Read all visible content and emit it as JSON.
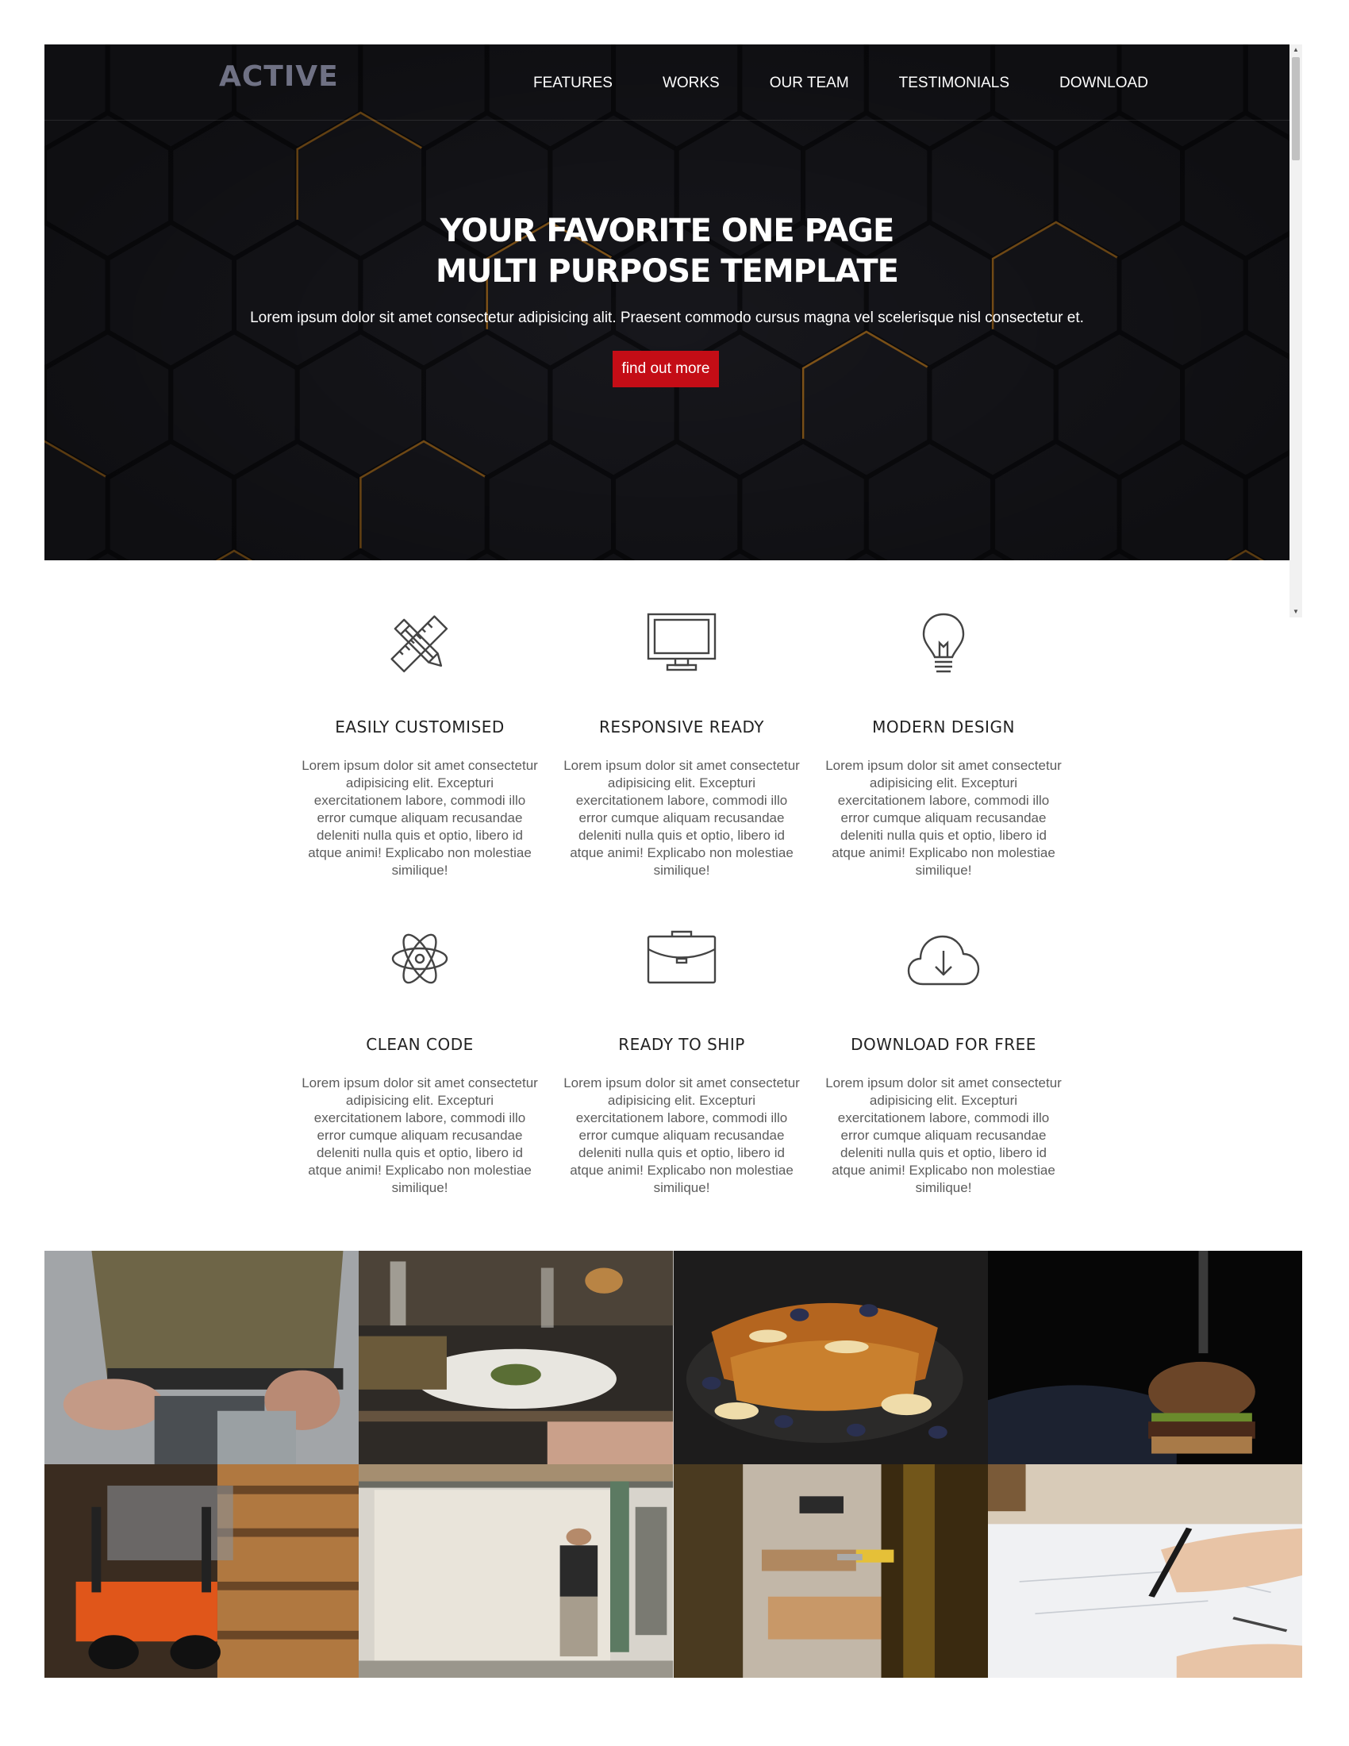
{
  "brand": {
    "logo": "ACTIVE"
  },
  "nav": {
    "items": [
      {
        "label": "FEATURES"
      },
      {
        "label": "WORKS"
      },
      {
        "label": "OUR TEAM"
      },
      {
        "label": "TESTIMONIALS"
      },
      {
        "label": "DOWNLOAD"
      }
    ]
  },
  "hero": {
    "title_line1": "YOUR FAVORITE ONE PAGE",
    "title_line2": "MULTI PURPOSE TEMPLATE",
    "subtitle": "Lorem ipsum dolor sit amet consectetur adipisicing alit. Praesent commodo cursus magna vel scelerisque nisl consectetur et.",
    "button_label": "find out more",
    "colors": {
      "background": "#121216",
      "accent_line": "#8a5a1a",
      "button": "#c40d16"
    }
  },
  "features": [
    {
      "icon": "pencil-ruler-icon",
      "title": "EASILY CUSTOMISED",
      "text": "Lorem ipsum dolor sit amet consectetur adipisicing elit. Excepturi exercitationem labore, commodi illo error cumque aliquam recusandae deleniti nulla quis et optio, libero id atque animi! Explicabo non molestiae similique!"
    },
    {
      "icon": "monitor-icon",
      "title": "RESPONSIVE READY",
      "text": "Lorem ipsum dolor sit amet consectetur adipisicing elit. Excepturi exercitationem labore, commodi illo error cumque aliquam recusandae deleniti nulla quis et optio, libero id atque animi! Explicabo non molestiae similique!"
    },
    {
      "icon": "lightbulb-icon",
      "title": "MODERN DESIGN",
      "text": "Lorem ipsum dolor sit amet consectetur adipisicing elit. Excepturi exercitationem labore, commodi illo error cumque aliquam recusandae deleniti nulla quis et optio, libero id atque animi! Explicabo non molestiae similique!"
    },
    {
      "icon": "atom-icon",
      "title": "CLEAN CODE",
      "text": "Lorem ipsum dolor sit amet consectetur adipisicing elit. Excepturi exercitationem labore, commodi illo error cumque aliquam recusandae deleniti nulla quis et optio, libero id atque animi! Explicabo non molestiae similique!"
    },
    {
      "icon": "briefcase-icon",
      "title": "READY TO SHIP",
      "text": "Lorem ipsum dolor sit amet consectetur adipisicing elit. Excepturi exercitationem labore, commodi illo error cumque aliquam recusandae deleniti nulla quis et optio, libero id atque animi! Explicabo non molestiae similique!"
    },
    {
      "icon": "cloud-download-icon",
      "title": "DOWNLOAD FOR FREE",
      "text": "Lorem ipsum dolor sit amet consectetur adipisicing elit. Excepturi exercitationem labore, commodi illo error cumque aliquam recusandae deleniti nulla quis et optio, libero id atque animi! Explicabo non molestiae similique!"
    }
  ],
  "gallery": {
    "images": [
      "carpenter-working-photo",
      "restaurant-dinner-table-photo",
      "french-toast-blueberries-photo",
      "burger-with-knife-photo",
      "orange-forklift-warehouse-photo",
      "man-walking-workshop-photo",
      "woodworking-tools-photo",
      "hand-drawing-blueprint-photo"
    ]
  }
}
